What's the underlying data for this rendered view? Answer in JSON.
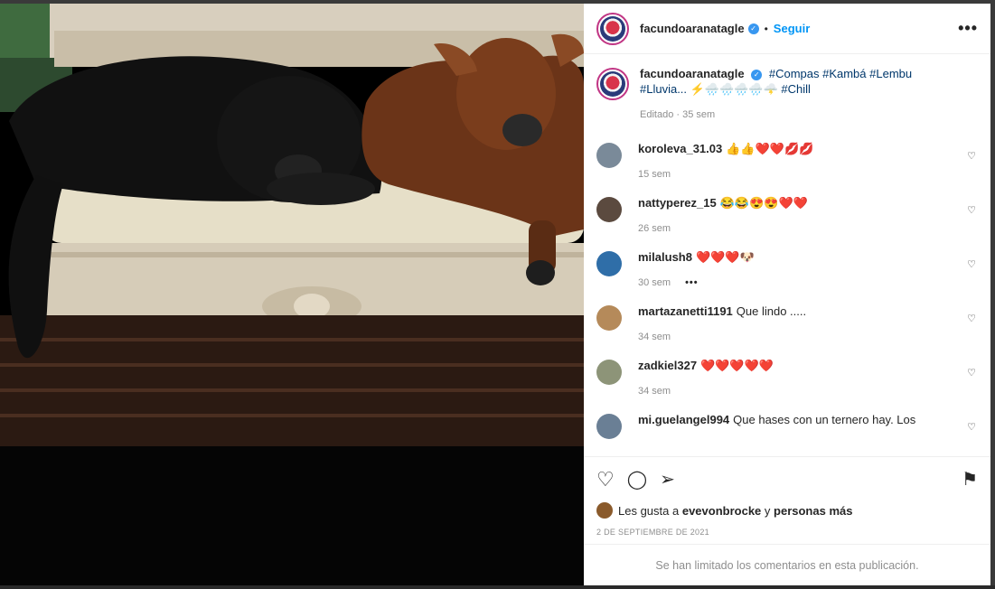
{
  "post": {
    "username": "facundoaranatagle",
    "verified_badge": "✓",
    "dot": "•",
    "follow_label": "Seguir",
    "more_label": "•••",
    "caption_text": "#Compas #Kambá #Lembu #Lluvia... ⚡🌧️🌧️🌧️🌧️🌩️ #Chill",
    "caption_meta": "Editado · 35 sem"
  },
  "comments": [
    {
      "user": "koroleva_31.03",
      "text": "👍👍❤️❤️💋💋",
      "time": "15 sem",
      "color": "#7a8a99"
    },
    {
      "user": "nattyperez_15",
      "text": "😂😂😍😍❤️❤️",
      "time": "26 sem",
      "color": "#5b4a3f"
    },
    {
      "user": "milalush8",
      "text": "❤️❤️❤️🐶",
      "time": "30 sem",
      "color": "#2f6ea8",
      "more": "•••"
    },
    {
      "user": "martazanetti1191",
      "text": "Que lindo .....",
      "time": "34 sem",
      "color": "#b58a5a"
    },
    {
      "user": "zadkiel327",
      "text": "❤️❤️❤️❤️❤️",
      "time": "34 sem",
      "color": "#8d9478"
    },
    {
      "user": "mi.guelangel994",
      "text": "Que hases con un ternero hay. Los",
      "time": "",
      "color": "#6a7f95"
    }
  ],
  "actions": {
    "like_icon": "♡",
    "comment_icon": "◯",
    "share_icon": "➢",
    "save_icon": "⚑",
    "likes_prefix": "Les gusta a",
    "likes_user": "evevonbrocke",
    "likes_mid": "y",
    "likes_rest": "personas más",
    "date": "2 DE SEPTIEMBRE DE 2021",
    "limited_text": "Se han limitado los comentarios en esta publicación."
  },
  "icons": {
    "comment_heart": "♡"
  }
}
